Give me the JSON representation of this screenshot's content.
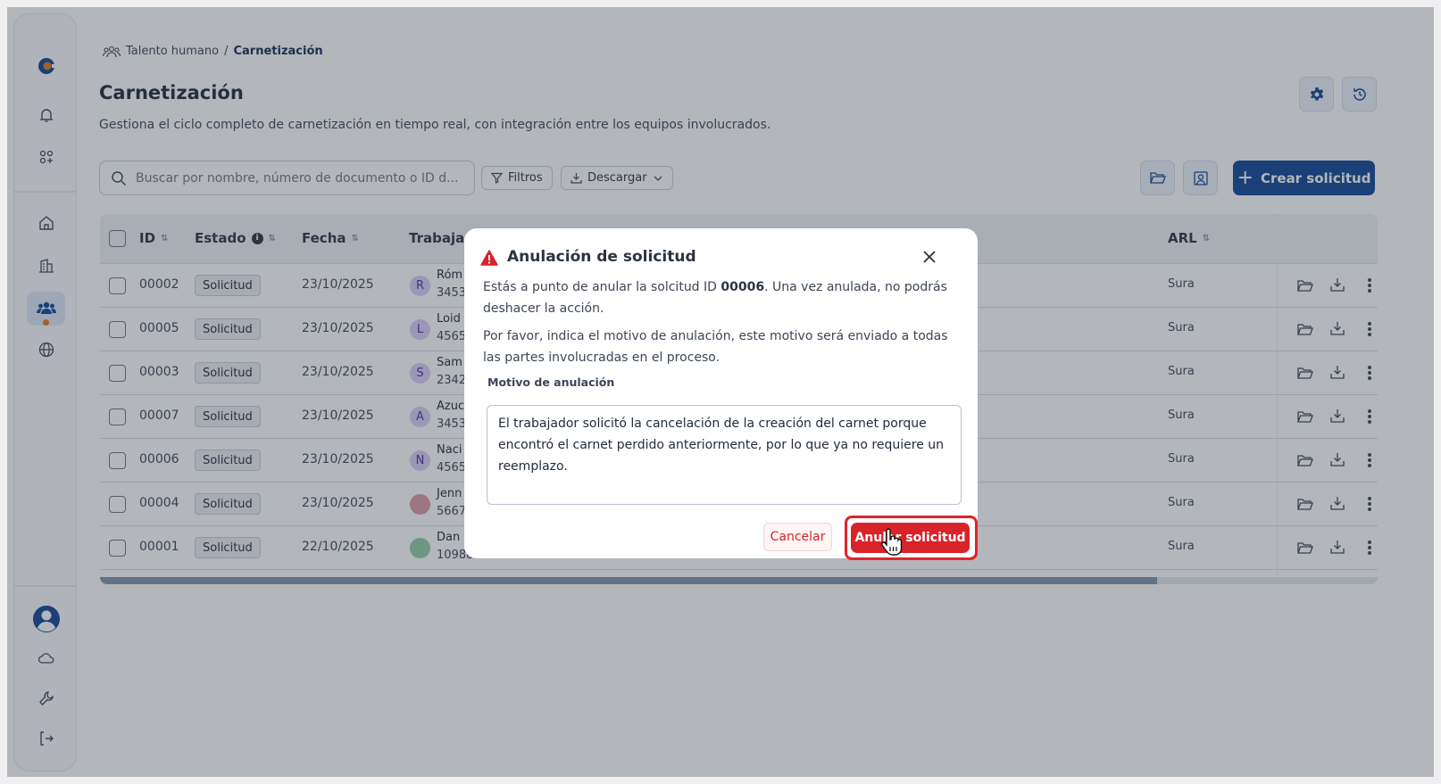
{
  "breadcrumb": {
    "parent": "Talento humano",
    "separator": "/",
    "current": "Carnetización"
  },
  "page": {
    "title": "Carnetización",
    "subtitle": "Gestiona el ciclo completo de carnetización en tiempo real, con integración entre los equipos involucrados."
  },
  "toolbar": {
    "search_placeholder": "Buscar por nombre, número de documento o ID d...",
    "filters_label": "Filtros",
    "download_label": "Descargar",
    "create_label": "Crear solicitud"
  },
  "table": {
    "headers": {
      "id": "ID",
      "estado": "Estado",
      "fecha": "Fecha",
      "trabajador": "Trabajad",
      "arl": "ARL"
    },
    "rows": [
      {
        "id": "00002",
        "estado": "Solicitud",
        "fecha": "23/10/2025",
        "initial": "R",
        "name": "Róm",
        "doc": "3453"
      },
      {
        "id": "00005",
        "estado": "Solicitud",
        "fecha": "23/10/2025",
        "initial": "L",
        "name": "Loid",
        "doc": "4565"
      },
      {
        "id": "00003",
        "estado": "Solicitud",
        "fecha": "23/10/2025",
        "initial": "S",
        "name": "Sam",
        "doc": "2342"
      },
      {
        "id": "00007",
        "estado": "Solicitud",
        "fecha": "23/10/2025",
        "initial": "A",
        "name": "Azuc",
        "doc": "3453"
      },
      {
        "id": "00006",
        "estado": "Solicitud",
        "fecha": "23/10/2025",
        "initial": "N",
        "name": "Naci",
        "doc": "4565"
      },
      {
        "id": "00004",
        "estado": "Solicitud",
        "fecha": "23/10/2025",
        "initial": "",
        "name": "Jenn",
        "doc": "5667"
      },
      {
        "id": "00001",
        "estado": "Solicitud",
        "fecha": "22/10/2025",
        "initial": "",
        "name": "Dan",
        "doc": "1098810170"
      }
    ],
    "arl": "Sura"
  },
  "dialog": {
    "title": "Anulación de solicitud",
    "text1_a": "Estás a punto de anular la solcitud ID ",
    "text1_id": "00006",
    "text1_b": ". Una vez anulada, no podrás deshacer la acción.",
    "text2": "Por favor, indica el motivo de anulación, este motivo será enviado a todas las partes involucradas en el proceso.",
    "field_label": "Motivo de anulación",
    "field_value": "El trabajador solicitó la cancelación de la creación del carnet porque encontró el carnet perdido anteriormente, por lo que ya no requiere un reemplazo.",
    "cancel_label": "Cancelar",
    "confirm_label": "Anular solicitud"
  },
  "colors": {
    "brand": "#0e4493",
    "danger": "#d8232a",
    "accent": "#e07a1f"
  }
}
